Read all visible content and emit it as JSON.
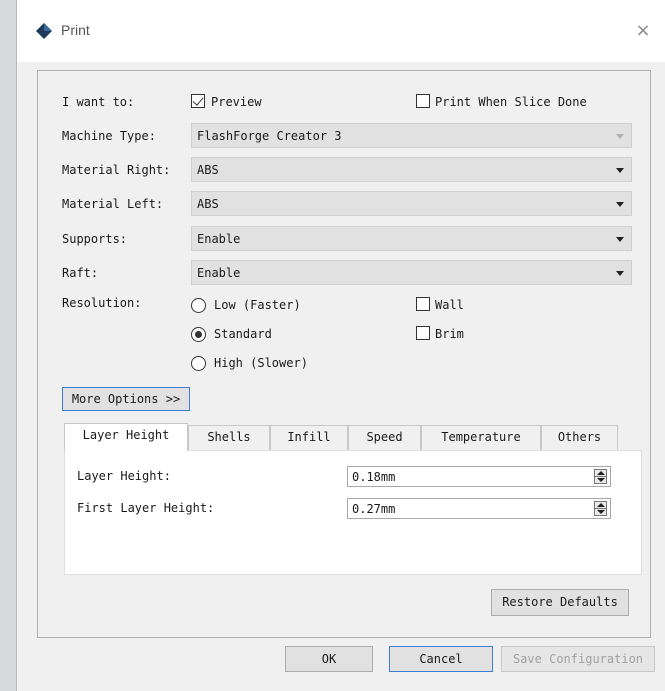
{
  "window": {
    "title": "Print",
    "close_glyph": "×",
    "icon": "flashforge-diamond-icon"
  },
  "options": {
    "i_want_to_label": "I want to:",
    "preview": {
      "label": "Preview",
      "checked": true
    },
    "print_when_done": {
      "label": "Print When Slice Done",
      "checked": false
    }
  },
  "fields": {
    "machine_type": {
      "label": "Machine Type:",
      "value": "FlashForge Creator 3",
      "disabled": true
    },
    "material_right": {
      "label": "Material Right:",
      "value": "ABS"
    },
    "material_left": {
      "label": "Material Left:",
      "value": "ABS"
    },
    "supports": {
      "label": "Supports:",
      "value": "Enable"
    },
    "raft": {
      "label": "Raft:",
      "value": "Enable"
    }
  },
  "resolution": {
    "label": "Resolution:",
    "low": {
      "label": "Low (Faster)",
      "checked": false
    },
    "standard": {
      "label": "Standard",
      "checked": true
    },
    "high": {
      "label": "High (Slower)",
      "checked": false
    },
    "wall": {
      "label": "Wall",
      "checked": false
    },
    "brim": {
      "label": "Brim",
      "checked": false
    }
  },
  "more_options_label": "More Options >>",
  "tabs": [
    {
      "label": "Layer Height",
      "active": true
    },
    {
      "label": "Shells"
    },
    {
      "label": "Infill"
    },
    {
      "label": "Speed"
    },
    {
      "label": "Temperature"
    },
    {
      "label": "Others"
    }
  ],
  "layer": {
    "layer_height": {
      "label": "Layer Height:",
      "value": "0.18mm"
    },
    "first_layer_height": {
      "label": "First Layer Height:",
      "value": "0.27mm"
    }
  },
  "buttons": {
    "restore_defaults": "Restore Defaults",
    "ok": "OK",
    "cancel": "Cancel",
    "save_configuration": "Save Configuration"
  },
  "colors": {
    "accent": "#3c7fd4",
    "window_bg": "#f0f0f0",
    "combo_bg": "#e1e1e1"
  }
}
